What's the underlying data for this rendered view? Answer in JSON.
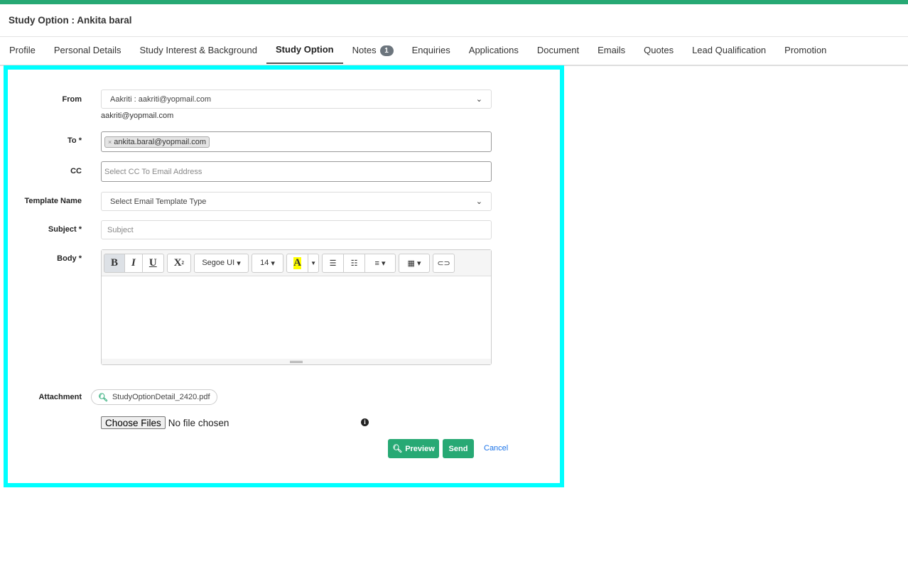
{
  "header": {
    "title": "Study Option : Ankita baral"
  },
  "tabs": [
    {
      "label": "Profile"
    },
    {
      "label": "Personal Details"
    },
    {
      "label": "Study Interest & Background"
    },
    {
      "label": "Study Option",
      "active": true
    },
    {
      "label": "Notes",
      "badge": "1"
    },
    {
      "label": "Enquiries"
    },
    {
      "label": "Applications"
    },
    {
      "label": "Document"
    },
    {
      "label": "Emails"
    },
    {
      "label": "Quotes"
    },
    {
      "label": "Lead Qualification"
    },
    {
      "label": "Promotion"
    }
  ],
  "form": {
    "from_label": "From",
    "from_value": "Aakriti : aakriti@yopmail.com",
    "from_helper": "aakriti@yopmail.com",
    "to_label": "To *",
    "to_chip": "ankita.baral@yopmail.com",
    "to_chip_remove": "×",
    "cc_label": "CC",
    "cc_placeholder": "Select CC To Email Address",
    "template_label": "Template Name",
    "template_value": "Select Email Template Type",
    "subject_label": "Subject *",
    "subject_placeholder": "Subject",
    "body_label": "Body *",
    "toolbar": {
      "bold": "B",
      "italic": "I",
      "underline": "U",
      "superscript": "X",
      "font": "Segoe UI",
      "size": "14",
      "color": "A"
    },
    "attachment_label": "Attachment",
    "attachment_file": "StudyOptionDetail_2420.pdf",
    "choose_files": "Choose Files",
    "no_file": "No file chosen",
    "preview": "Preview",
    "send": "Send",
    "cancel": "Cancel"
  },
  "colors": {
    "accent": "#27a974",
    "highlight": "#00ffff"
  }
}
